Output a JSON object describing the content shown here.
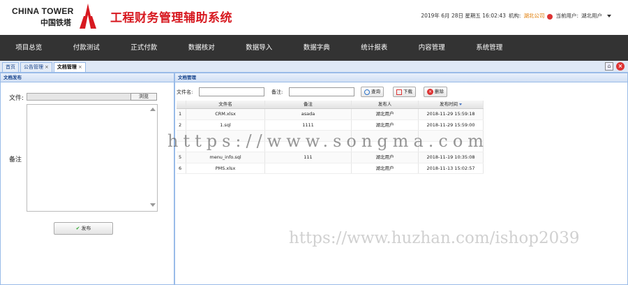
{
  "header": {
    "logo_en": "CHINA TOWER",
    "logo_cn": "中国铁塔",
    "system_title": "工程财务管理辅助系统",
    "datetime": "2019年 6月 28日 星期五 16:02:43",
    "org_label": "机构:",
    "org_value": "湖北公司",
    "user_label": "当前用户:",
    "user_value": "湖北用户"
  },
  "nav": {
    "items": [
      "项目总览",
      "付款测试",
      "正式付款",
      "数据核对",
      "数据导入",
      "数据字典",
      "统计报表",
      "内容管理",
      "系统管理"
    ]
  },
  "tabs": [
    {
      "label": "首页",
      "closable": false
    },
    {
      "label": "公告管理",
      "closable": true
    },
    {
      "label": "文档管理",
      "closable": true
    }
  ],
  "left_panel": {
    "title": "文档发布",
    "file_label": "文件:",
    "browse_label": "浏览",
    "remark_label": "备注",
    "publish_label": "发布"
  },
  "right_panel": {
    "title": "文档管理",
    "filename_label": "文件名:",
    "remark_label": "备注:",
    "search_label": "查询",
    "download_label": "下载",
    "delete_label": "删除"
  },
  "table": {
    "columns": [
      "",
      "文件名",
      "备注",
      "发布人",
      "发布时间"
    ],
    "rows": [
      {
        "no": "1",
        "name": "CRM.xlsx",
        "remark": "asada",
        "publisher": "湖北用户",
        "time": "2018-11-29 15:59:18"
      },
      {
        "no": "2",
        "name": "1.sql",
        "remark": "1111",
        "publisher": "湖北用户",
        "time": "2018-11-29 15:59:00"
      },
      {
        "no": "",
        "name": "",
        "remark": "",
        "publisher": "",
        "time": ""
      },
      {
        "no": "",
        "name": "",
        "remark": "",
        "publisher": "",
        "time": ""
      },
      {
        "no": "5",
        "name": "menu_info.sql",
        "remark": "111",
        "publisher": "湖北用户",
        "time": "2018-11-19 10:35:08"
      },
      {
        "no": "6",
        "name": "PMS.xlsx",
        "remark": "",
        "publisher": "湖北用户",
        "time": "2018-11-13 15:02:57"
      }
    ]
  },
  "watermarks": [
    "https://www.songma.com",
    "https://www.huzhan.com/ishop2039"
  ],
  "colors": {
    "brand_red": "#d71920",
    "nav_bg": "#333333",
    "org_orange": "#e07a00"
  }
}
